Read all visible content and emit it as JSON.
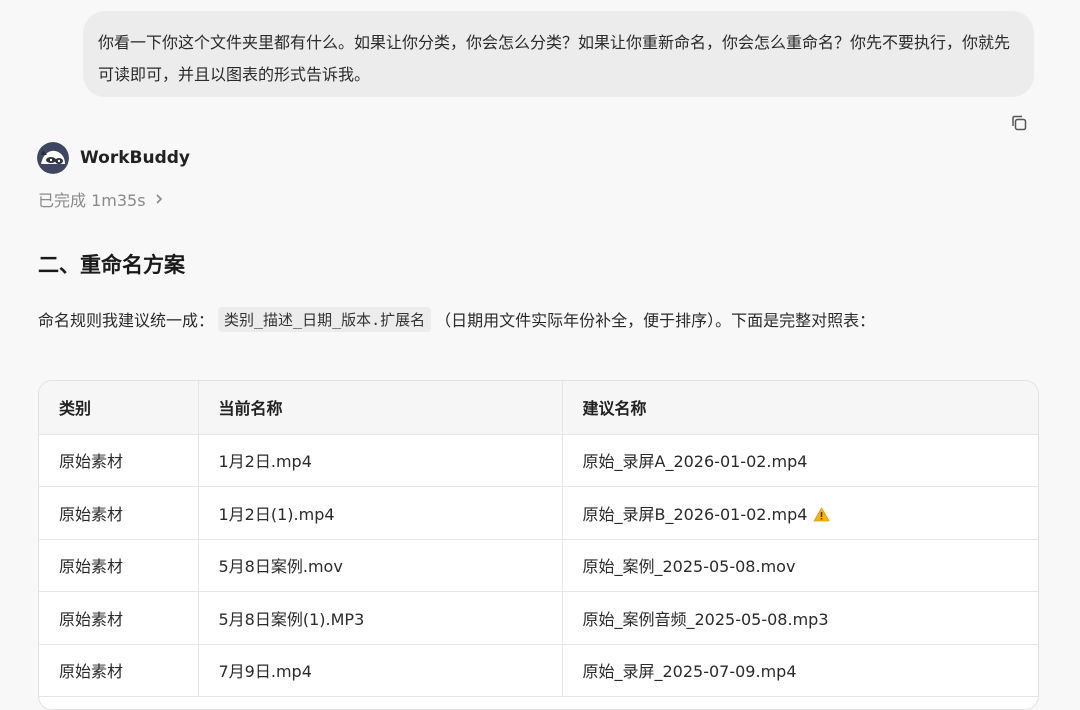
{
  "user_message": "你看一下你这个文件夹里都有什么。如果让你分类，你会怎么分类？如果让你重新命名，你会怎么重命名？你先不要执行，你就先可读即可，并且以图表的形式告诉我。",
  "assistant": {
    "name": "WorkBuddy",
    "status": "已完成 1m35s"
  },
  "section": {
    "title": "二、重命名方案",
    "rule_prefix": "命名规则我建议统一成：",
    "rule_code": "类别_描述_日期_版本.扩展名",
    "rule_suffix": "（日期用文件实际年份补全，便于排序）。下面是完整对照表："
  },
  "table": {
    "headers": [
      "类别",
      "当前名称",
      "建议名称"
    ],
    "rows": [
      {
        "category": "原始素材",
        "current": "1月2日.mp4",
        "suggested": "原始_录屏A_2026-01-02.mp4",
        "warning": false
      },
      {
        "category": "原始素材",
        "current": "1月2日(1).mp4",
        "suggested": "原始_录屏B_2026-01-02.mp4",
        "warning": true
      },
      {
        "category": "原始素材",
        "current": "5月8日案例.mov",
        "suggested": "原始_案例_2025-05-08.mov",
        "warning": false
      },
      {
        "category": "原始素材",
        "current": "5月8日案例(1).MP3",
        "suggested": "原始_案例音频_2025-05-08.mp3",
        "warning": false
      },
      {
        "category": "原始素材",
        "current": "7月9日.mp4",
        "suggested": "原始_录屏_2025-07-09.mp4",
        "warning": false
      }
    ]
  },
  "icons": {
    "copy": "copy-icon",
    "avatar": "raccoon-avatar-icon",
    "chevron": "chevron-right-icon",
    "warning": "warning-icon"
  },
  "colors": {
    "bubble": "#ececec",
    "background": "#f8f8f8",
    "warning": "#f4b400"
  }
}
